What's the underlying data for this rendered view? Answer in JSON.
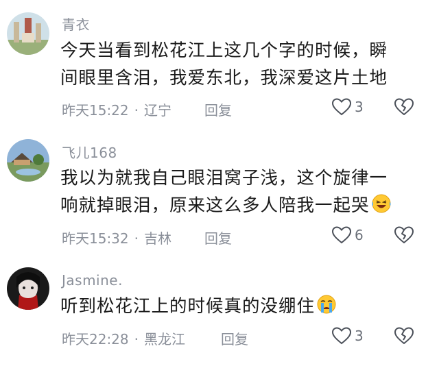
{
  "comments": [
    {
      "username": "青衣",
      "lines": [
        "今天当看到松花江上这几个字的时候，瞬",
        "间眼里含泪，我爱东北，我深爱这片土地"
      ],
      "emoji": "",
      "time": "昨天15:22",
      "location": "辽宁",
      "reply_label": "回复",
      "likes": "3",
      "avatar_icon": "avatar-scenic-icon"
    },
    {
      "username": "飞儿168",
      "lines": [
        "我以为就我自己眼泪窝子浅，这个旋律一",
        "响就掉眼泪，原来这么多人陪我一起哭"
      ],
      "emoji": "laughing-crying-emoji",
      "time": "昨天15:32",
      "location": "吉林",
      "reply_label": "回复",
      "likes": "6",
      "avatar_icon": "avatar-landscape-icon"
    },
    {
      "username": "Jasmine.",
      "lines": [
        "听到松花江上的时候真的没绷住"
      ],
      "emoji": "crying-emoji",
      "time": "昨天22:28",
      "location": "黑龙江",
      "reply_label": "回复",
      "likes": "3",
      "avatar_icon": "avatar-portrait-icon"
    }
  ],
  "separator": "·",
  "colors": {
    "text": "#1a1a1a",
    "meta": "#8a8f99",
    "background": "#ffffff"
  }
}
